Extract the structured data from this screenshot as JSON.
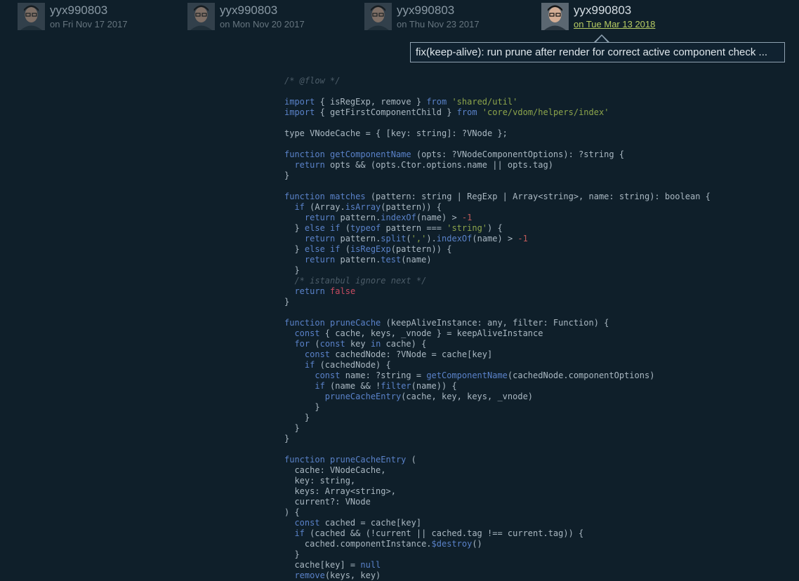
{
  "commits": [
    {
      "author": "yyx990803",
      "date": "on Fri Nov 17 2017",
      "active": false
    },
    {
      "author": "yyx990803",
      "date": "on Mon Nov 20 2017",
      "active": false
    },
    {
      "author": "yyx990803",
      "date": "on Thu Nov 23 2017",
      "active": false
    },
    {
      "author": "yyx990803",
      "date": "on Tue Mar 13 2018",
      "active": true
    }
  ],
  "tooltip": {
    "message": "fix(keep-alive): run prune after render for correct active component check ..."
  },
  "colors": {
    "background": "#0f1f2a",
    "keyword": "#5a82c9",
    "string": "#8da54b",
    "comment": "#4c5c68",
    "active_date": "#b7cc63"
  },
  "code_lines": [
    [
      [
        "cm",
        "/* @flow */"
      ]
    ],
    [],
    [
      [
        "kw",
        "import"
      ],
      [
        "",
        " { isRegExp, remove } "
      ],
      [
        "kw",
        "from"
      ],
      [
        "",
        " "
      ],
      [
        "str",
        "'shared/util'"
      ]
    ],
    [
      [
        "kw",
        "import"
      ],
      [
        "",
        " { getFirstComponentChild } "
      ],
      [
        "kw",
        "from"
      ],
      [
        "",
        " "
      ],
      [
        "str",
        "'core/vdom/helpers/index'"
      ]
    ],
    [],
    [
      [
        "",
        "type VNodeCache = { [key: string]: ?VNode };"
      ]
    ],
    [],
    [
      [
        "kw",
        "function"
      ],
      [
        "",
        " "
      ],
      [
        "fn",
        "getComponentName"
      ],
      [
        "",
        " (opts: ?VNodeComponentOptions): ?string {"
      ]
    ],
    [
      [
        "",
        "  "
      ],
      [
        "kw",
        "return"
      ],
      [
        "",
        " opts && (opts.Ctor.options.name || opts.tag)"
      ]
    ],
    [
      [
        "",
        "}"
      ]
    ],
    [],
    [
      [
        "kw",
        "function"
      ],
      [
        "",
        " "
      ],
      [
        "fn",
        "matches"
      ],
      [
        "",
        " (pattern: string | RegExp | Array<string>, name: string): boolean {"
      ]
    ],
    [
      [
        "",
        "  "
      ],
      [
        "kw",
        "if"
      ],
      [
        "",
        " (Array."
      ],
      [
        "fn",
        "isArray"
      ],
      [
        "",
        "(pattern)) {"
      ]
    ],
    [
      [
        "",
        "    "
      ],
      [
        "kw",
        "return"
      ],
      [
        "",
        " pattern."
      ],
      [
        "fn",
        "indexOf"
      ],
      [
        "",
        "(name) > "
      ],
      [
        "num",
        "-1"
      ]
    ],
    [
      [
        "",
        "  } "
      ],
      [
        "kw",
        "else if"
      ],
      [
        "",
        " ("
      ],
      [
        "kw",
        "typeof"
      ],
      [
        "",
        " pattern === "
      ],
      [
        "str",
        "'string'"
      ],
      [
        "",
        ") {"
      ]
    ],
    [
      [
        "",
        "    "
      ],
      [
        "kw",
        "return"
      ],
      [
        "",
        " pattern."
      ],
      [
        "fn",
        "split"
      ],
      [
        "",
        "("
      ],
      [
        "str",
        "','"
      ],
      [
        "",
        ")."
      ],
      [
        "fn",
        "indexOf"
      ],
      [
        "",
        "(name) > "
      ],
      [
        "num",
        "-1"
      ]
    ],
    [
      [
        "",
        "  } "
      ],
      [
        "kw",
        "else if"
      ],
      [
        "",
        " ("
      ],
      [
        "fn",
        "isRegExp"
      ],
      [
        "",
        "(pattern)) {"
      ]
    ],
    [
      [
        "",
        "    "
      ],
      [
        "kw",
        "return"
      ],
      [
        "",
        " pattern."
      ],
      [
        "fn",
        "test"
      ],
      [
        "",
        "(name)"
      ]
    ],
    [
      [
        "",
        "  }"
      ]
    ],
    [
      [
        "",
        "  "
      ],
      [
        "cm",
        "/* istanbul ignore next */"
      ]
    ],
    [
      [
        "",
        "  "
      ],
      [
        "kw",
        "return"
      ],
      [
        "",
        " "
      ],
      [
        "bool",
        "false"
      ]
    ],
    [
      [
        "",
        "}"
      ]
    ],
    [],
    [
      [
        "kw",
        "function"
      ],
      [
        "",
        " "
      ],
      [
        "fn",
        "pruneCache"
      ],
      [
        "",
        " (keepAliveInstance: any, filter: Function) {"
      ]
    ],
    [
      [
        "",
        "  "
      ],
      [
        "kw",
        "const"
      ],
      [
        "",
        " { cache, keys, _vnode } = keepAliveInstance"
      ]
    ],
    [
      [
        "",
        "  "
      ],
      [
        "kw",
        "for"
      ],
      [
        "",
        " ("
      ],
      [
        "kw",
        "const"
      ],
      [
        "",
        " key "
      ],
      [
        "kw",
        "in"
      ],
      [
        "",
        " cache) {"
      ]
    ],
    [
      [
        "",
        "    "
      ],
      [
        "kw",
        "const"
      ],
      [
        "",
        " cachedNode: ?VNode = cache[key]"
      ]
    ],
    [
      [
        "",
        "    "
      ],
      [
        "kw",
        "if"
      ],
      [
        "",
        " (cachedNode) {"
      ]
    ],
    [
      [
        "",
        "      "
      ],
      [
        "kw",
        "const"
      ],
      [
        "",
        " name: ?string = "
      ],
      [
        "fn",
        "getComponentName"
      ],
      [
        "",
        "(cachedNode.componentOptions)"
      ]
    ],
    [
      [
        "",
        "      "
      ],
      [
        "kw",
        "if"
      ],
      [
        "",
        " (name && !"
      ],
      [
        "fn",
        "filter"
      ],
      [
        "",
        "(name)) {"
      ]
    ],
    [
      [
        "",
        "        "
      ],
      [
        "fn",
        "pruneCacheEntry"
      ],
      [
        "",
        "(cache, key, keys, _vnode)"
      ]
    ],
    [
      [
        "",
        "      }"
      ]
    ],
    [
      [
        "",
        "    }"
      ]
    ],
    [
      [
        "",
        "  }"
      ]
    ],
    [
      [
        "",
        "}"
      ]
    ],
    [],
    [
      [
        "kw",
        "function"
      ],
      [
        "",
        " "
      ],
      [
        "fn",
        "pruneCacheEntry"
      ],
      [
        "",
        " ("
      ]
    ],
    [
      [
        "",
        "  cache: VNodeCache,"
      ]
    ],
    [
      [
        "",
        "  key: string,"
      ]
    ],
    [
      [
        "",
        "  keys: Array<string>,"
      ]
    ],
    [
      [
        "",
        "  current?: VNode"
      ]
    ],
    [
      [
        "",
        ") {"
      ]
    ],
    [
      [
        "",
        "  "
      ],
      [
        "kw",
        "const"
      ],
      [
        "",
        " cached = cache[key]"
      ]
    ],
    [
      [
        "",
        "  "
      ],
      [
        "kw",
        "if"
      ],
      [
        "",
        " (cached && (!current || cached.tag !== current.tag)) {"
      ]
    ],
    [
      [
        "",
        "    cached.componentInstance."
      ],
      [
        "fn",
        "$destroy"
      ],
      [
        "",
        "()"
      ]
    ],
    [
      [
        "",
        "  }"
      ]
    ],
    [
      [
        "",
        "  cache[key] = "
      ],
      [
        "kw",
        "null"
      ]
    ],
    [
      [
        "",
        "  "
      ],
      [
        "fn",
        "remove"
      ],
      [
        "",
        "(keys, key)"
      ]
    ]
  ]
}
